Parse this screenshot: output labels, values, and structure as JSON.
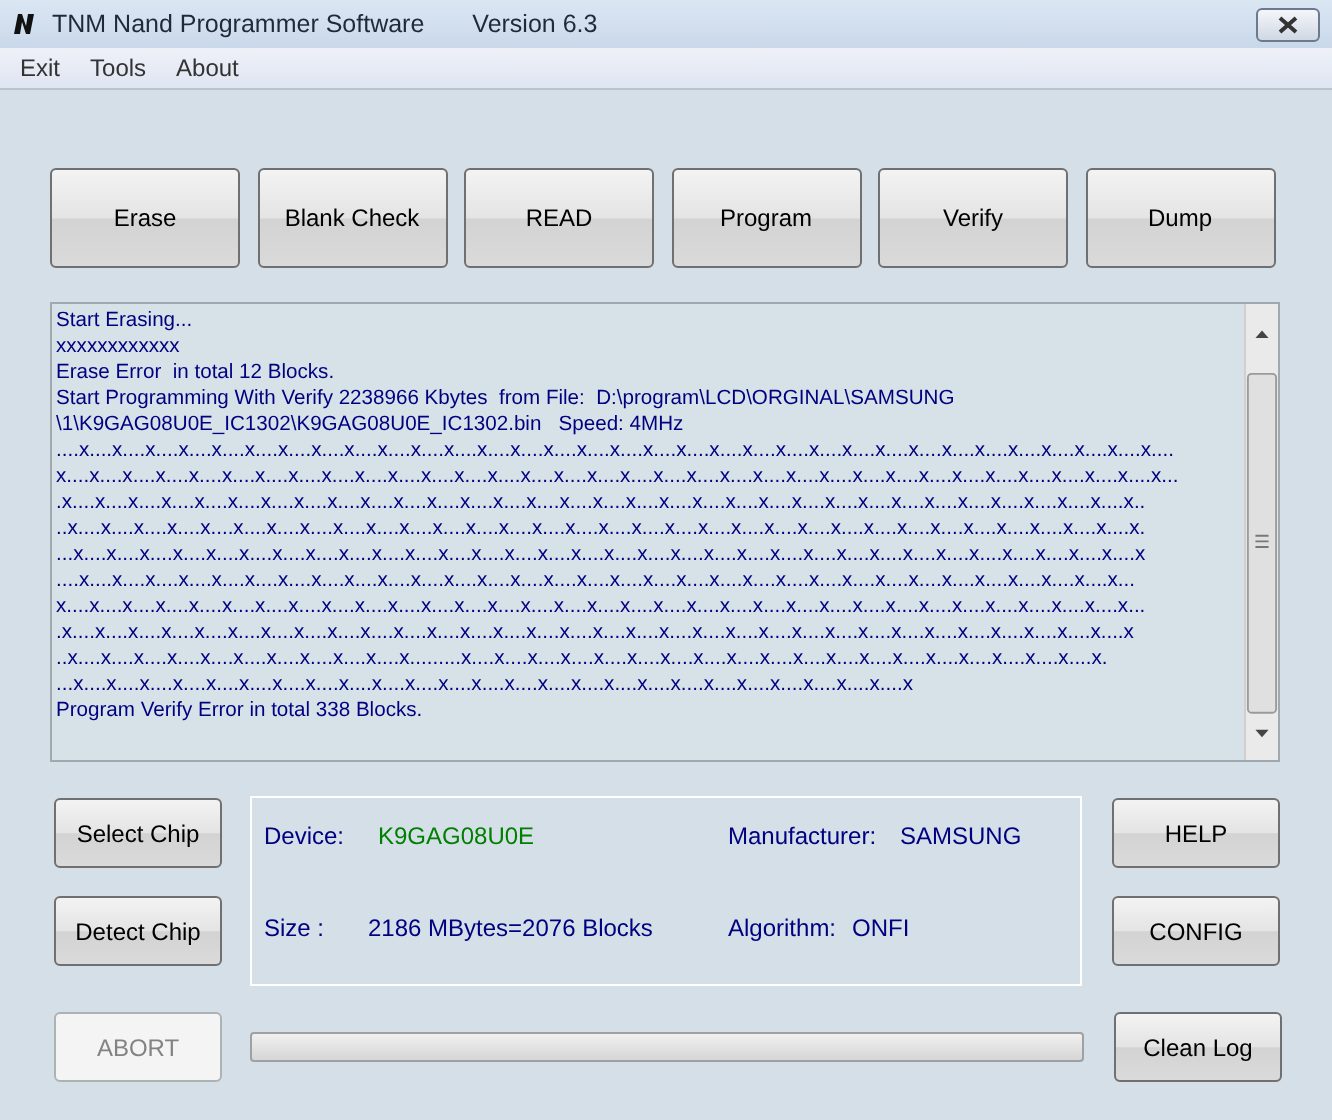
{
  "window": {
    "title": "TNM  Nand Programmer Software",
    "version": "Version 6.3"
  },
  "menu": [
    "Exit",
    "Tools",
    "About"
  ],
  "actions": [
    "Erase",
    "Blank  Check",
    "READ",
    "Program",
    "Verify",
    "Dump"
  ],
  "log": {
    "lines": [
      "Start Erasing...",
      "xxxxxxxxxxxx",
      "Erase Error  in total 12 Blocks.",
      "Start Programming With Verify 2238966 Kbytes  from File:  D:\\program\\LCD\\ORGINAL\\SAMSUNG",
      "\\1\\K9GAG08U0E_IC1302\\K9GAG08U0E_IC1302.bin   Speed: 4MHz",
      "....x....x....x....x....x....x....x....x....x....x....x....x....x....x....x....x....x....x....x....x....x....x....x....x....x....x....x....x....x....x....x....x....x....",
      "x....x....x....x....x....x....x....x....x....x....x....x....x....x....x....x....x....x....x....x....x....x....x....x....x....x....x....x....x....x....x....x....x....x...",
      ".x....x....x....x....x....x....x....x....x....x....x....x....x....x....x....x....x....x....x....x....x....x....x....x....x....x....x....x....x....x....x....x....x..",
      "..x....x....x....x....x....x....x....x....x....x....x....x....x....x....x....x....x....x....x....x....x....x....x....x....x....x....x....x....x....x....x....x....x.",
      "...x....x....x....x....x....x....x....x....x....x....x....x....x....x....x....x....x....x....x....x....x....x....x....x....x....x....x....x....x....x....x....x....x",
      "....x....x....x....x....x....x....x....x....x....x....x....x....x....x....x....x....x....x....x....x....x....x....x....x....x....x....x....x....x....x....x....x...",
      "x....x....x....x....x....x....x....x....x....x....x....x....x....x....x....x....x....x....x....x....x....x....x....x....x....x....x....x....x....x....x....x....x...",
      ".x....x....x....x....x....x....x....x....x....x....x....x....x....x....x....x....x....x....x....x....x....x....x....x....x....x....x....x....x....x....x....x....x",
      "..x....x....x....x....x....x....x....x....x....x....x.........x....x....x....x....x....x....x....x....x....x....x....x....x....x....x....x....x....x....x....x.",
      "...x....x....x....x....x....x....x....x....x....x....x....x....x....x....x....x....x....x....x....x....x....x....x....x....x....x",
      "Program Verify Error in total 338 Blocks."
    ]
  },
  "left_buttons": [
    "Select Chip",
    "Detect Chip"
  ],
  "info": [
    {
      "label": "Device:",
      "value": "K9GAG08U0E",
      "color": "#008000"
    },
    {
      "label": "Manufacturer:",
      "value": "SAMSUNG",
      "color": "#000080"
    },
    {
      "label": "Size :",
      "value": "2186 MBytes=2076 Blocks",
      "color": "#000080"
    },
    {
      "label": "Algorithm:",
      "value": "ONFI",
      "color": "#000080"
    }
  ],
  "right_buttons": [
    "HELP",
    "CONFIG"
  ],
  "abort": {
    "label": "ABORT",
    "disabled": true
  },
  "progress": {
    "level": 0
  },
  "clean_log": "Clean Log"
}
